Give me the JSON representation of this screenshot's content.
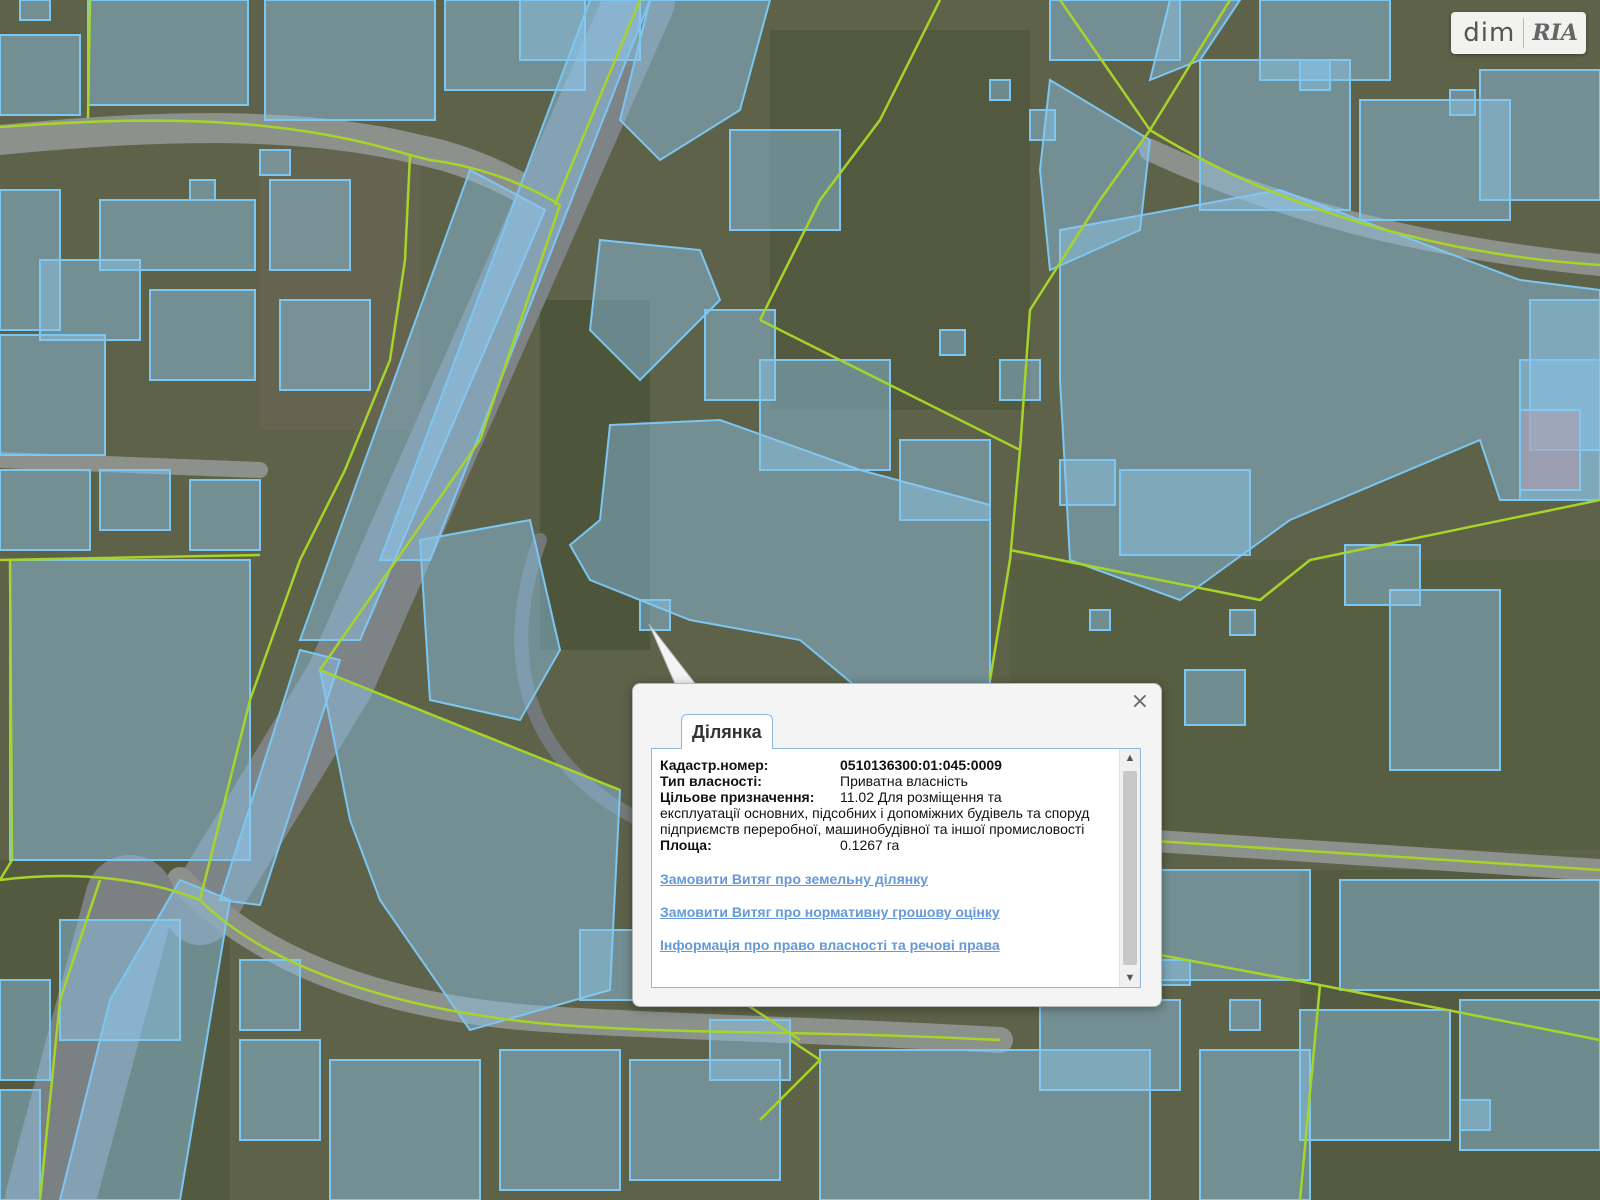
{
  "watermark": {
    "brand_left": "dim",
    "brand_right": "RIA"
  },
  "popup": {
    "tab_label": "Ділянка",
    "close_label": "×",
    "fields": {
      "cadastral_label": "Кадастр.номер:",
      "cadastral_value": "0510136300:01:045:0009",
      "ownership_label": "Тип власності:",
      "ownership_value": "Приватна власність",
      "purpose_label": "Цільове призначення:",
      "purpose_value_first": "11.02 Для розміщення та",
      "purpose_value_rest": "експлуатації основних, підсобних і допоміжних будівель та споруд підприємств переробної, машинобудівної та іншої промисловості",
      "area_label": "Площа:",
      "area_value": "0.1267 га"
    },
    "links": [
      "Замовити Витяг про земельну ділянку",
      "Замовити Витяг про нормативну грошову оцінку",
      "Інформація про право власності та речові права"
    ]
  },
  "colors": {
    "parcel_fill": "#8ec7ee",
    "parcel_stroke": "#7cc6f2",
    "boundary": "#a6d42a",
    "link": "#6699d8"
  }
}
